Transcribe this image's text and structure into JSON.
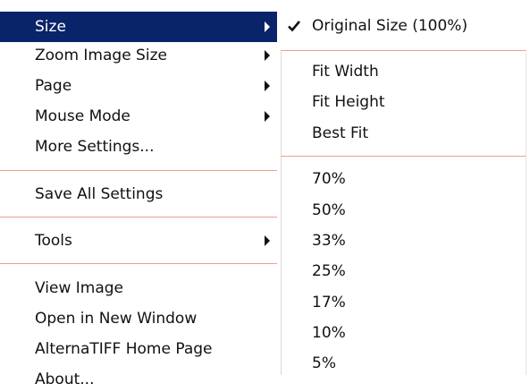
{
  "main_menu": {
    "items": [
      {
        "label": "Size"
      },
      {
        "label": "Zoom Image Size"
      },
      {
        "label": "Page"
      },
      {
        "label": "Mouse Mode"
      },
      {
        "label": "More Settings..."
      },
      {
        "label": "Save All Settings"
      },
      {
        "label": "Tools"
      },
      {
        "label": "View Image"
      },
      {
        "label": "Open in New Window"
      },
      {
        "label": "AlternaTIFF Home Page"
      },
      {
        "label": "About..."
      }
    ],
    "highlight_color": "#0a246a"
  },
  "size_submenu": {
    "items": [
      {
        "label": "Original Size (100%)",
        "checked": true
      },
      {
        "label": "Fit Width"
      },
      {
        "label": "Fit Height"
      },
      {
        "label": "Best Fit"
      },
      {
        "label": "70%"
      },
      {
        "label": "50%"
      },
      {
        "label": "33%"
      },
      {
        "label": "25%"
      },
      {
        "label": "17%"
      },
      {
        "label": "10%"
      },
      {
        "label": "5%"
      }
    ]
  },
  "separator_color": "#e8a38a",
  "icons": {
    "submenu_arrow": "submenu-arrow-icon",
    "check": "checkmark-icon"
  }
}
